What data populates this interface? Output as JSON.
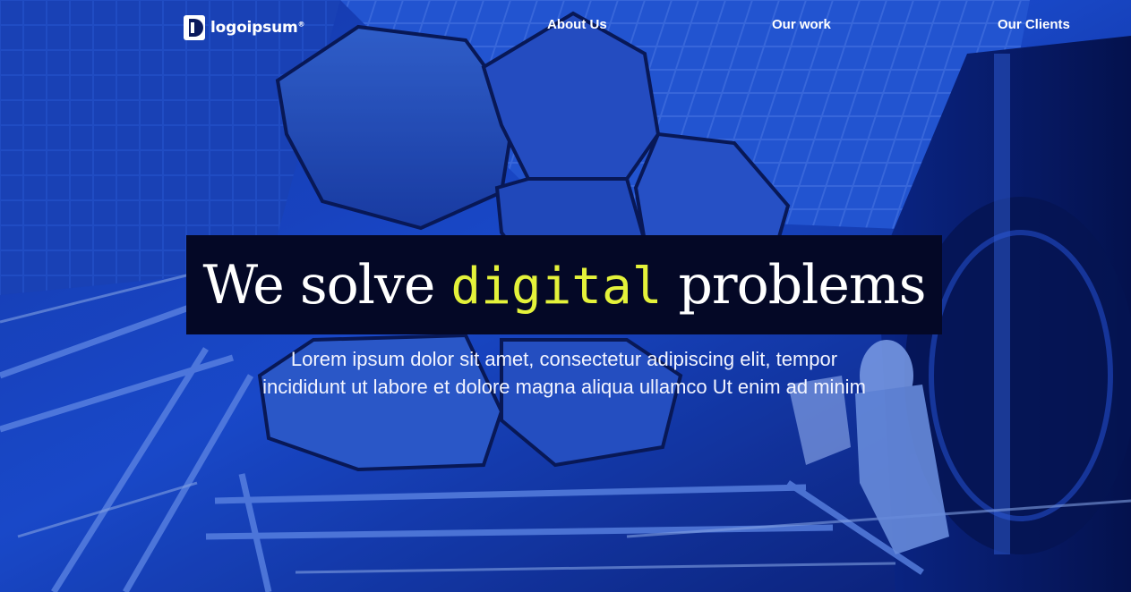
{
  "header": {
    "logo_text": "logoipsum",
    "logo_mark": "®",
    "nav": [
      {
        "label": "About Us"
      },
      {
        "label": "Our work"
      },
      {
        "label": "Our Clients"
      }
    ]
  },
  "hero": {
    "title_before": "We solve ",
    "title_accent": "digital",
    "title_after": " problems",
    "subtitle": "Lorem ipsum dolor sit amet, consectetur adipiscing elit, tempor incididunt ut labore et dolore magna aliqua ullamco Ut enim ad minim"
  },
  "theme": {
    "accent": "#e4f23a",
    "hero_box": "#040826",
    "background_blue": "#1f4fd6"
  },
  "icons": {
    "logo": "logoipsum-mark-icon"
  }
}
